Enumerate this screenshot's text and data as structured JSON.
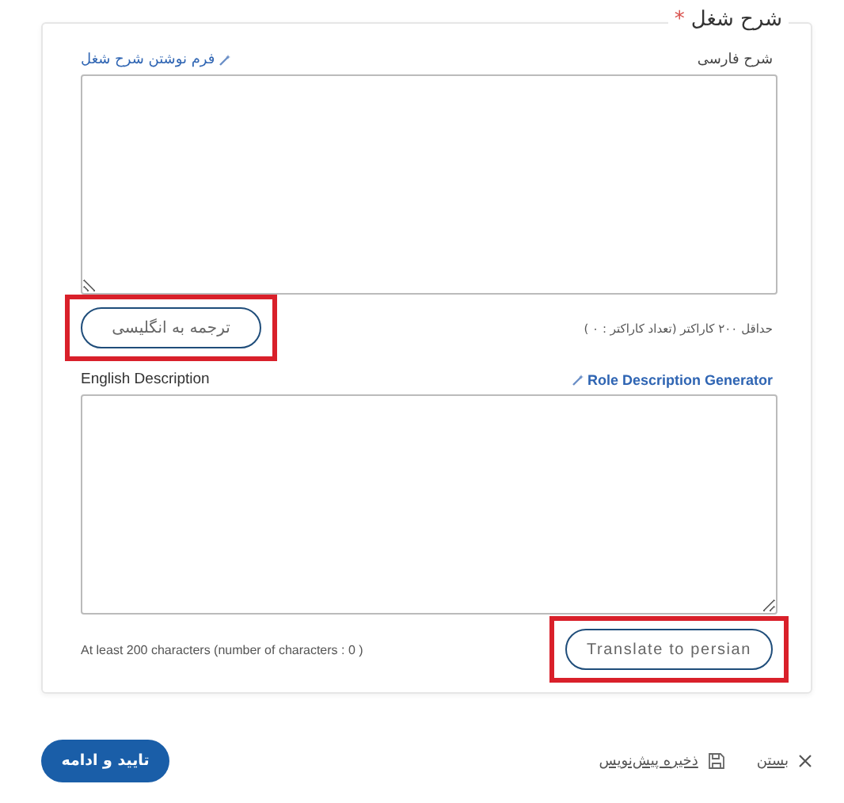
{
  "section": {
    "title": "شرح شغل",
    "required_mark": "*"
  },
  "persian": {
    "label": "شرح فارسی",
    "helper_link": "فرم نوشتن شرح شغل",
    "hint": "حداقل ۲۰۰ کاراکتر (تعداد کاراکتر : ۰ )",
    "button": "ترجمه به انگلیسی",
    "highlighted": true
  },
  "english": {
    "label": "English Description",
    "helper_link": "Role Description Generator",
    "hint": "At least 200 characters (number of characters : 0 )",
    "button": "Translate to persian",
    "highlighted": true
  },
  "footer": {
    "close": "بستن",
    "save_draft": "ذخیره پیش‌نویس",
    "confirm": "تایید و ادامه"
  }
}
